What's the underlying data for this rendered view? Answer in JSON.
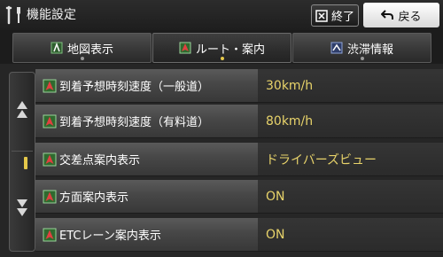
{
  "header": {
    "title": "機能設定",
    "end_label": "終了",
    "back_label": "戻る"
  },
  "tabs": [
    {
      "label": "地図表示",
      "icon": "map-display-icon",
      "active": false
    },
    {
      "label": "ルート・案内",
      "icon": "route-guide-icon",
      "active": true
    },
    {
      "label": "渋滞情報",
      "icon": "traffic-info-icon",
      "active": false
    }
  ],
  "settings": [
    {
      "label": "到着予想時刻速度（一般道）",
      "value": "30km/h"
    },
    {
      "label": "到着予想時刻速度（有料道）",
      "value": "80km/h"
    },
    {
      "label": "交差点案内表示",
      "value": "ドライバーズビュー"
    },
    {
      "label": "方面案内表示",
      "value": "ON"
    },
    {
      "label": "ETCレーン案内表示",
      "value": "ON"
    }
  ],
  "colors": {
    "accent": "#e5c84a",
    "value_text": "#e8d36a",
    "background": "#262626"
  }
}
